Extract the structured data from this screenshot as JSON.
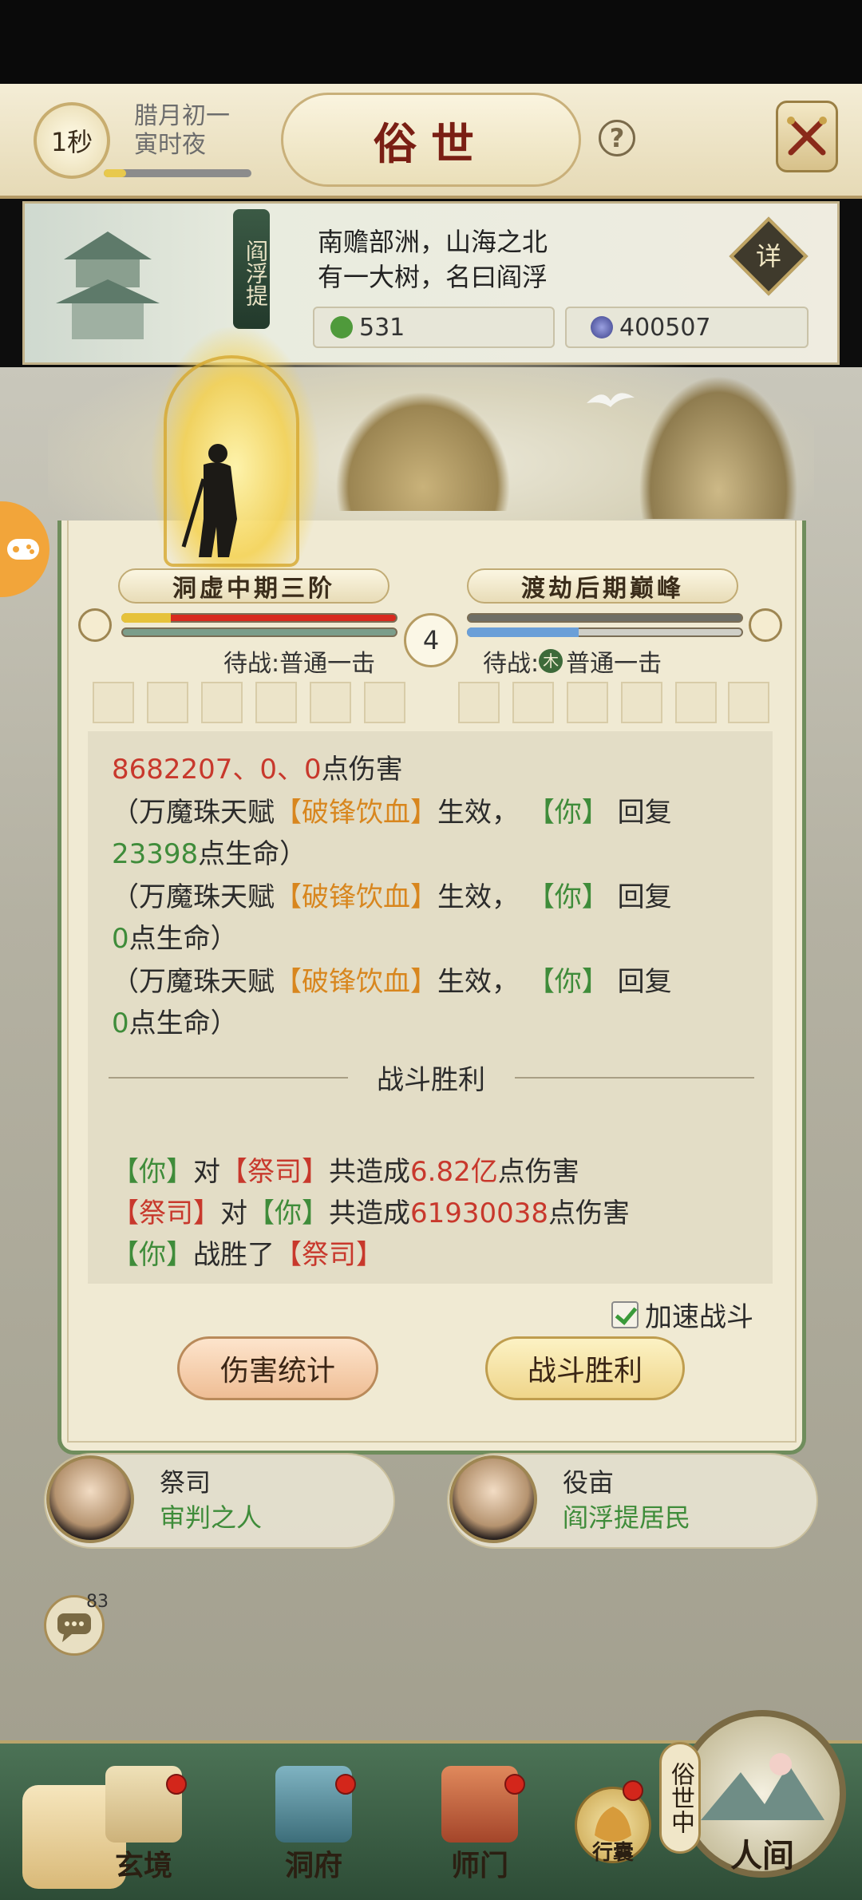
{
  "header": {
    "timer": "1秒",
    "date_line1": "腊月初一",
    "date_line2": "寅时夜",
    "title": "俗世",
    "help": "?"
  },
  "region": {
    "tag": "阎浮提",
    "desc_line1": "南赡部洲，山海之北",
    "desc_line2": "有一大树，名曰阎浮",
    "detail_label": "详",
    "resource1": "531",
    "resource2": "400507",
    "resource1_color": "#4f9a3b",
    "resource2_color": "#3a3f8a"
  },
  "battle": {
    "player_rank": "洞虚中期三阶",
    "enemy_rank": "渡劫后期巅峰",
    "round": "4",
    "player_status": "待战:普通一击",
    "enemy_status_prefix": "待战:",
    "enemy_element": "木",
    "enemy_status_action": "普通一击",
    "player_hp_ratio": 1.0,
    "enemy_mp_ratio": 0.4
  },
  "log": {
    "line1_dmg": "8682207、0、0",
    "line1_suffix": "点伤害",
    "effect_prefix": "（万魔珠天赋",
    "effect_talent": "【破锋饮血】",
    "effect_mid": "生效，",
    "effect_you": "【你】",
    "effect_heal": "回复",
    "heal1": "23398",
    "heal2": "0",
    "heal3": "0",
    "heal_suffix": "点生命）",
    "victory_title": "战斗胜利",
    "sum_you": "【你】",
    "sum_dui": "对",
    "sum_priest": "【祭司】",
    "sum_total": "共造成",
    "sum_you_dmg": "6.82亿",
    "sum_priest_dmg": "61930038",
    "sum_dmg_suffix": "点伤害",
    "sum_win": "战胜了"
  },
  "controls": {
    "speed_label": "加速战斗",
    "btn_stats": "伤害统计",
    "btn_victory": "战斗胜利"
  },
  "npcs": [
    {
      "name": "祭司",
      "role": "审判之人"
    },
    {
      "name": "役亩",
      "role": "阎浮提居民"
    }
  ],
  "chat": {
    "count": "83"
  },
  "nav": {
    "items": [
      "玄境",
      "洞府",
      "师门",
      "行囊",
      "人间"
    ],
    "world_tag": "俗世中"
  }
}
